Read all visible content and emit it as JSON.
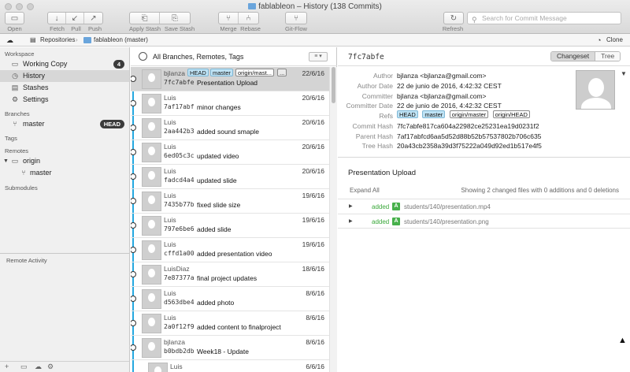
{
  "window": {
    "title": "fablableon – History (138 Commits)"
  },
  "toolbar": {
    "open": "Open",
    "fetch": "Fetch",
    "pull": "Pull",
    "push": "Push",
    "apply_stash": "Apply Stash",
    "save_stash": "Save Stash",
    "merge": "Merge",
    "rebase": "Rebase",
    "gitflow": "Git-Flow",
    "refresh": "Refresh",
    "search_placeholder": "Search for Commit Message"
  },
  "pathbar": {
    "repositories": "Repositories",
    "repo": "fablableon (master)",
    "clone": "Clone"
  },
  "sidebar": {
    "workspace": "Workspace",
    "working_copy": "Working Copy",
    "working_copy_count": "4",
    "history": "History",
    "stashes": "Stashes",
    "settings": "Settings",
    "branches": "Branches",
    "master": "master",
    "head_badge": "HEAD",
    "tags": "Tags",
    "remotes": "Remotes",
    "origin": "origin",
    "origin_master": "master",
    "submodules": "Submodules",
    "remote_activity": "Remote Activity"
  },
  "list": {
    "header": "All Branches, Remotes, Tags",
    "commits": [
      {
        "author": "bjlanza",
        "hash": "7fc7abfe",
        "message": "Presentation Upload",
        "date": "22/6/16",
        "refs": [
          "HEAD",
          "master",
          "origin/mast..."
        ],
        "more": "..."
      },
      {
        "author": "Luis",
        "hash": "7af17abf",
        "message": "minor changes",
        "date": "20/6/16"
      },
      {
        "author": "Luis",
        "hash": "2aa442b3",
        "message": "added sound smaple",
        "date": "20/6/16"
      },
      {
        "author": "Luis",
        "hash": "6ed05c3c",
        "message": "updated video",
        "date": "20/6/16"
      },
      {
        "author": "Luis",
        "hash": "fadcd4a4",
        "message": "updated slide",
        "date": "20/6/16"
      },
      {
        "author": "Luis",
        "hash": "7435b77b",
        "message": "fixed slide size",
        "date": "19/6/16"
      },
      {
        "author": "Luis",
        "hash": "797e6be6",
        "message": "added slide",
        "date": "19/6/16"
      },
      {
        "author": "Luis",
        "hash": "cffd1a00",
        "message": "added presentation video",
        "date": "19/6/16"
      },
      {
        "author": "LuisDiaz",
        "hash": "7e87377a",
        "message": "final project updates",
        "date": "18/6/16"
      },
      {
        "author": "Luis",
        "hash": "d563dbe4",
        "message": "added photo",
        "date": "8/6/16"
      },
      {
        "author": "Luis",
        "hash": "2a0f12f9",
        "message": "added content to finalproject",
        "date": "8/6/16"
      },
      {
        "author": "bjlanza",
        "hash": "b0bdb2db",
        "message": "Week18 - Update",
        "date": "8/6/16"
      },
      {
        "author": "Luis",
        "hash": "",
        "message": "",
        "date": "6/6/16"
      }
    ]
  },
  "detail": {
    "hash": "7fc7abfe",
    "tab_changeset": "Changeset",
    "tab_tree": "Tree",
    "labels": {
      "author": "Author",
      "author_date": "Author Date",
      "committer": "Committer",
      "committer_date": "Committer Date",
      "refs": "Refs",
      "commit_hash": "Commit Hash",
      "parent_hash": "Parent Hash",
      "tree_hash": "Tree Hash"
    },
    "author": "bjlanza <bjlanza@gmail.com>",
    "author_date": "22 de junio de 2016, 4:42:32 CEST",
    "committer": "bjlanza <bjlanza@gmail.com>",
    "committer_date": "22 de junio de 2016, 4:42:32 CEST",
    "refs": [
      "HEAD",
      "master",
      "origin/master",
      "origin/HEAD"
    ],
    "commit_hash": "7fc7abfe817ca604a22982ce25231ea19d0231f2",
    "parent_hash": "7af17abfcd6aa5d52d88b52b57537802b706c635",
    "tree_hash": "20a43cb2358a39d3f75222a049d92ed1b517e4f5",
    "title": "Presentation Upload",
    "expand_all": "Expand All",
    "summary": "Showing 2 changed files with 0 additions and 0 deletions",
    "files": [
      {
        "status": "added",
        "badge": "A",
        "path": "students/140/presentation.mp4"
      },
      {
        "status": "added",
        "badge": "A",
        "path": "students/140/presentation.png"
      }
    ]
  },
  "colors": {
    "graph_line": "#25a8e0",
    "added_green": "#47b04b",
    "ref_blue": "#bfe3f5"
  }
}
